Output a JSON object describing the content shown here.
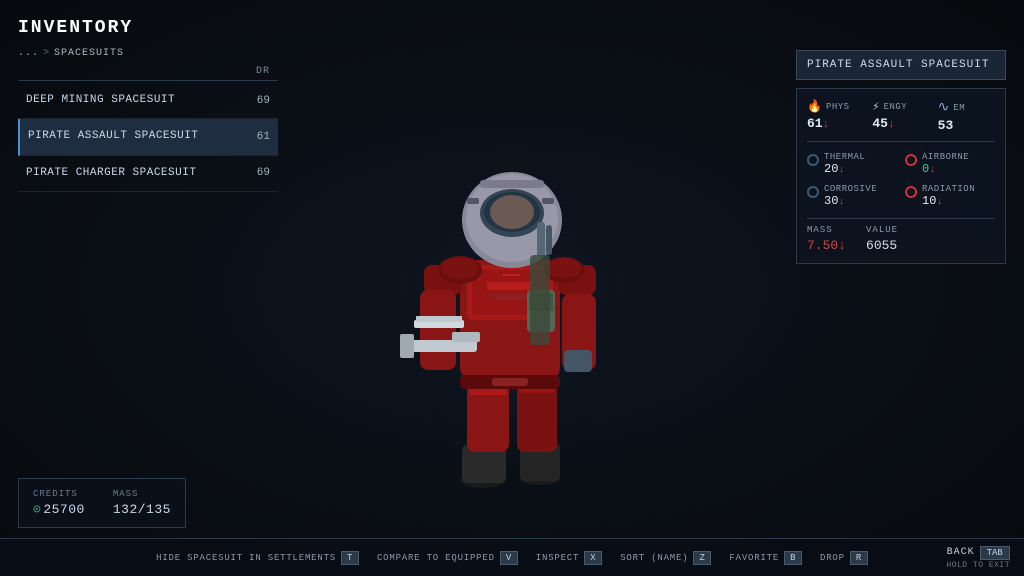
{
  "title": "INVENTORY",
  "breadcrumb": {
    "parent": "...",
    "current": "SPACESUITS",
    "separator": ">"
  },
  "list_header": {
    "name_col": "",
    "value_col": "DR"
  },
  "items": [
    {
      "name": "DEEP MINING SPACESUIT",
      "value": "69",
      "selected": false
    },
    {
      "name": "PIRATE ASSAULT\nSPACESUIT",
      "name_display": "PIRATE ASSAULT SPACESUIT",
      "value": "61",
      "selected": true
    },
    {
      "name": "PIRATE CHARGER\nSPACESUIT",
      "name_display": "PIRATE CHARGER SPACESUIT",
      "value": "69",
      "selected": false
    }
  ],
  "bottom_left": {
    "credits_label": "CREDITS",
    "credits_icon": "⊙",
    "credits_value": "25700",
    "mass_label": "MASS",
    "mass_value": "132/135"
  },
  "right_panel": {
    "item_title": "PIRATE ASSAULT SPACESUIT",
    "stats": {
      "phys_label": "PHYS",
      "phys_value": "61",
      "phys_down": "↓",
      "engy_label": "ENGY",
      "engy_value": "45",
      "engy_down": "↓",
      "em_label": "EM",
      "em_value": "53",
      "thermal_label": "THERMAL",
      "thermal_value": "20",
      "thermal_down": "↓",
      "airborne_label": "AIRBORNE",
      "airborne_value": "0",
      "airborne_down": "↓",
      "corrosive_label": "CORROSIVE",
      "corrosive_value": "30",
      "corrosive_down": "↓",
      "radiation_label": "RADIATION",
      "radiation_value": "10",
      "radiation_down": "↓",
      "mass_label": "MASS",
      "mass_value": "7.50",
      "mass_down": "↓",
      "value_label": "VALUE",
      "value_value": "6055"
    }
  },
  "bottom_bar": {
    "actions": [
      {
        "label": "HIDE SPACESUIT IN SETTLEMENTS",
        "key": "T"
      },
      {
        "label": "COMPARE TO EQUIPPED",
        "key": "V"
      },
      {
        "label": "INSPECT",
        "key": "X"
      },
      {
        "label": "SORT (NAME)",
        "key": "Z"
      },
      {
        "label": "FAVORITE",
        "key": "B"
      },
      {
        "label": "DROP",
        "key": "R"
      }
    ],
    "back_label": "BACK",
    "back_sub": "HOLD TO EXIT",
    "back_key": "TAB"
  },
  "icons": {
    "phys_icon": "🔥",
    "engy_icon": "⚡",
    "em_icon": "〜",
    "dot_icon": "●"
  }
}
